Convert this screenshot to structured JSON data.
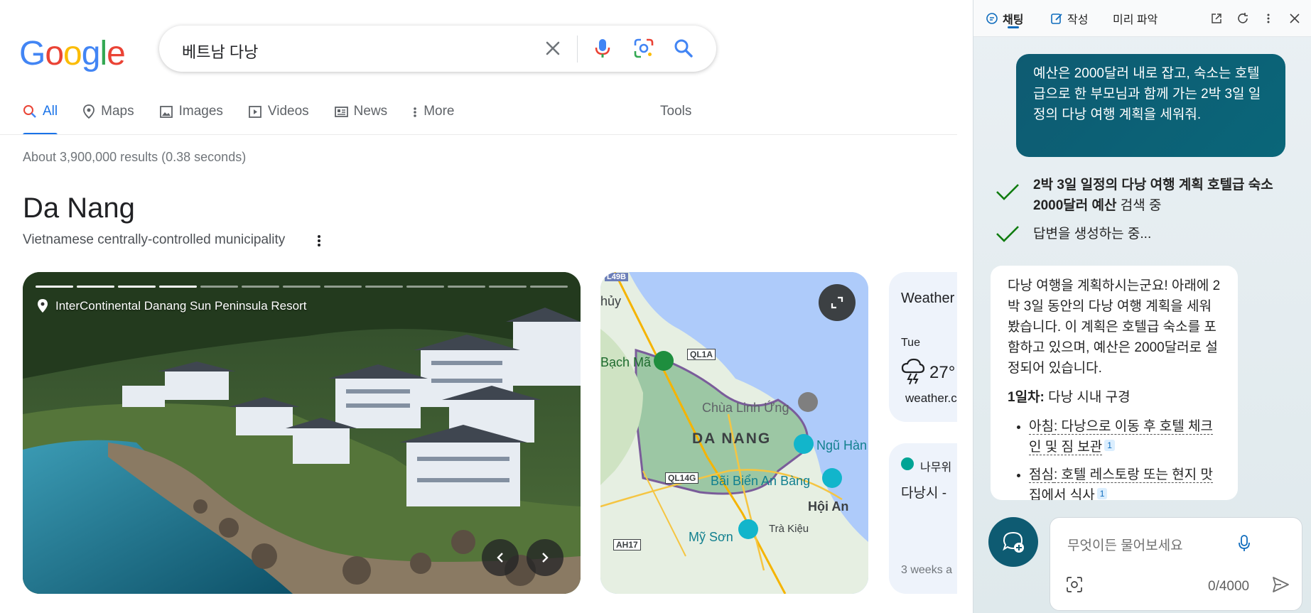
{
  "search": {
    "logo_letters": [
      "G",
      "o",
      "o",
      "g",
      "l",
      "e"
    ],
    "logo_colors": [
      "#4285f4",
      "#ea4335",
      "#fbbc05",
      "#4285f4",
      "#34a853",
      "#ea4335"
    ],
    "query": "베트남 다낭",
    "tabs": [
      {
        "label": "All",
        "icon": "search-icon",
        "active": true
      },
      {
        "label": "Maps",
        "icon": "map-pin-icon"
      },
      {
        "label": "Images",
        "icon": "image-icon"
      },
      {
        "label": "Videos",
        "icon": "video-icon"
      },
      {
        "label": "News",
        "icon": "news-icon"
      },
      {
        "label": "More",
        "icon": "more-vertical-icon"
      }
    ],
    "tools_label": "Tools",
    "stats": "About 3,900,000 results (0.38 seconds)"
  },
  "entity": {
    "title": "Da Nang",
    "subtitle": "Vietnamese centrally-controlled municipality",
    "photo_label": "InterContinental Danang Sun Peninsula Resort",
    "photo_progress": {
      "total": 13,
      "current": 4
    },
    "map_labels": {
      "road_top": "L49B",
      "thuy": "hủy",
      "bach_ma": "Bạch Mã",
      "ql1a": "QL1A",
      "chua": "Chùa Linh Ứng",
      "danang": "DA NANG",
      "ngu_hanh": "Ngũ Hàn",
      "ql14g": "QL14G",
      "bai_bien": "Bãi Biển An Bàng",
      "hoi_an": "Hội An",
      "my_son": "Mỹ Sơn",
      "tra_kieu": "Trà Kiệu",
      "ah17": "AH17"
    },
    "weather": {
      "title": "Weather",
      "day": "Tue",
      "temp": "27°",
      "source": "weather.c"
    },
    "news_card": {
      "source": "나무위",
      "text": "다낭시 -",
      "age": "3 weeks a"
    }
  },
  "copilot": {
    "tabs": [
      {
        "label": "채팅",
        "icon": "chat-icon",
        "active": true
      },
      {
        "label": "작성",
        "icon": "compose-icon"
      },
      {
        "label": "미리 파악",
        "icon": ""
      }
    ],
    "user_message": "예산은 2000달러 내로 잡고, 숙소는 호텔급으로 한 부모님과 함께 가는 2박 3일 일정의 다낭 여행 계획을 세워줘.",
    "progress": [
      {
        "bold": "2박 3일 일정의 다낭 여행 계획 호텔급 숙소 2000달러 예산",
        "rest": " 검색 중"
      },
      {
        "bold": "",
        "rest": "답변을 생성하는 중..."
      }
    ],
    "answer": {
      "intro": "다낭 여행을 계획하시는군요! 아래에 2박 3일 동안의 다낭 여행 계획을 세워봤습니다. 이 계획은 호텔급 숙소를 포함하고 있으며, 예산은 2000달러로 설정되어 있습니다.",
      "day1_bold": "1일차:",
      "day1_rest": " 다낭 시내 구경",
      "items": [
        {
          "label": "아침",
          "text": ": 다낭으로 이동 후 호텔 체크인 및 짐 보관",
          "cite": "1"
        },
        {
          "label": "점심",
          "text": ": 호텔 레스토랑 또는 현지 맛집에서 식사",
          "cite": "1"
        }
      ]
    },
    "composer": {
      "placeholder": "무엇이든 물어보세요",
      "count": "0/4000"
    },
    "accent": "#0e5b72"
  }
}
